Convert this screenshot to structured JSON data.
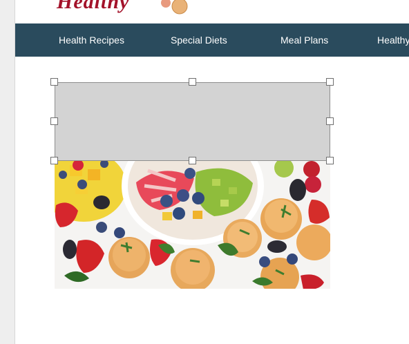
{
  "header": {
    "logo_text": "Healthy"
  },
  "nav": {
    "items": [
      {
        "label": "Health Recipes"
      },
      {
        "label": "Special Diets"
      },
      {
        "label": "Meal Plans"
      },
      {
        "label": "Healthy"
      }
    ]
  },
  "content": {
    "image_icon": "fruit-bowl-photo",
    "selection_icon": "resize-handle"
  },
  "colors": {
    "brand_red": "#a3122a",
    "nav_background": "#2a4b5d",
    "placeholder_gray": "#d3d3d3"
  }
}
